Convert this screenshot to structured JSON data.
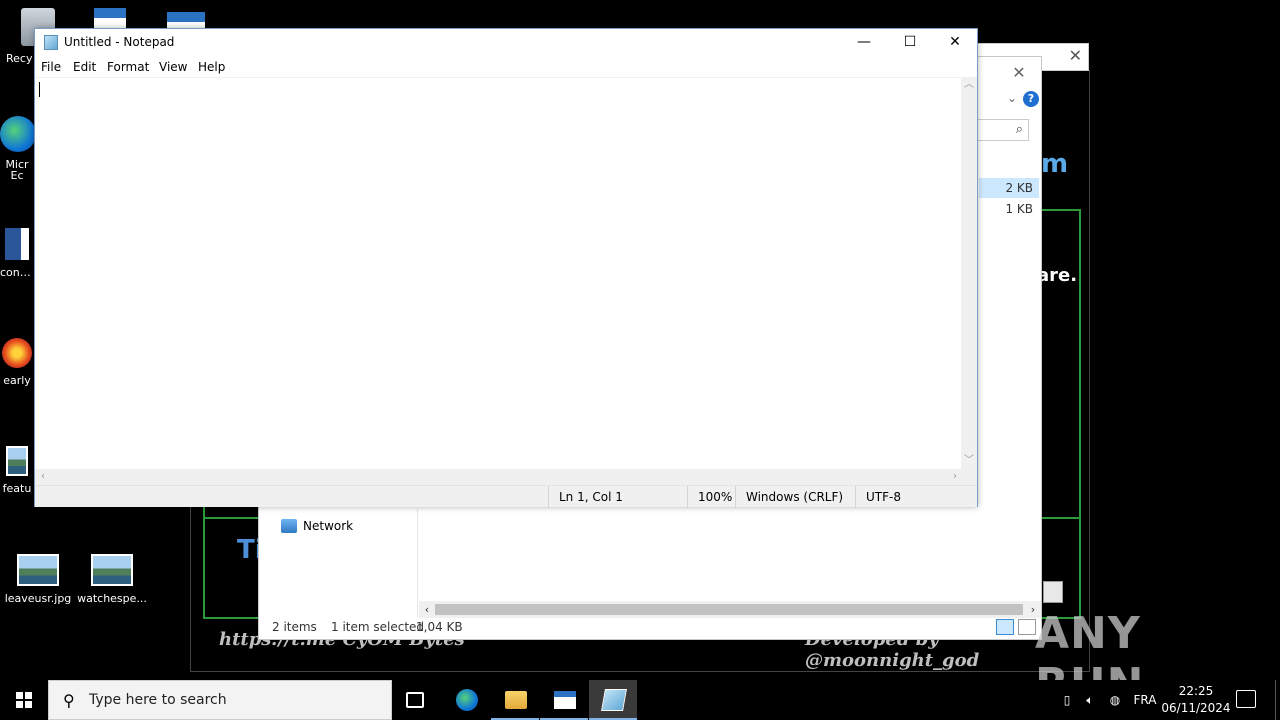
{
  "desktop": {
    "icons": [
      {
        "label": "Recy"
      },
      {
        "label": "Micr"
      },
      {
        "label": "Ec"
      },
      {
        "label": "contra"
      },
      {
        "label": "early"
      },
      {
        "label": "featu"
      },
      {
        "label": "leaveusr.jpg"
      },
      {
        "label": "watchespe..."
      }
    ]
  },
  "background_app": {
    "title_fragment": "m",
    "text_fragment": "are.",
    "blue_fragment": "Ti",
    "footer_left": "https://t.me  CyOM Bytes",
    "footer_right": "Developed by @moonnight_god"
  },
  "explorer": {
    "sizes": [
      "2 KB",
      "1 KB"
    ],
    "nav_network": "Network",
    "status_items": "2 items",
    "status_selected": "1 item selected",
    "status_size": "1,04 KB",
    "help_glyph": "?"
  },
  "notepad": {
    "title": "Untitled - Notepad",
    "menus": [
      "File",
      "Edit",
      "Format",
      "View",
      "Help"
    ],
    "content": "",
    "status": {
      "position": "Ln 1, Col 1",
      "zoom": "100%",
      "line_ending": "Windows (CRLF)",
      "encoding": "UTF-8"
    }
  },
  "taskbar": {
    "search_placeholder": "Type here to search",
    "language": "FRA",
    "time": "22:25",
    "date": "06/11/2024"
  },
  "watermark": "ANY RUN"
}
